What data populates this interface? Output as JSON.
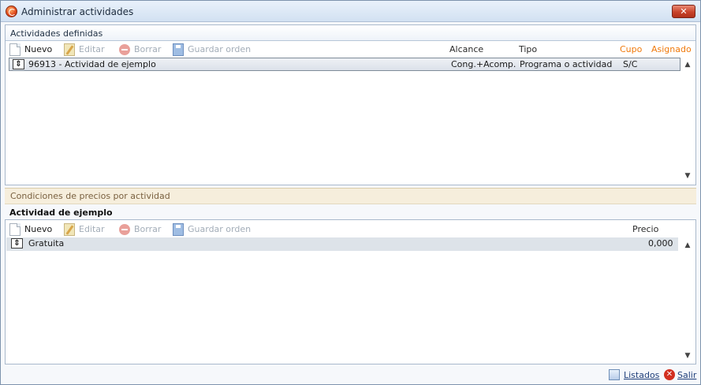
{
  "window": {
    "title": "Administrar actividades",
    "close_label": "✕"
  },
  "top_panel": {
    "header": "Actividades definidas",
    "toolbar": {
      "new": "Nuevo",
      "edit": "Editar",
      "delete": "Borrar",
      "save_order": "Guardar orden"
    },
    "columns": {
      "alcance": "Alcance",
      "tipo": "Tipo",
      "cupo": "Cupo",
      "asignado": "Asignado"
    },
    "rows": [
      {
        "name": "96913 - Actividad de ejemplo",
        "alcance": "Cong.+Acomp.",
        "tipo": "Programa o actividad",
        "cupo": "S/C",
        "asignado": ""
      }
    ]
  },
  "conditions": {
    "header": "Condiciones de precios por actividad",
    "activity_title": "Actividad de ejemplo",
    "toolbar": {
      "new": "Nuevo",
      "edit": "Editar",
      "delete": "Borrar",
      "save_order": "Guardar orden"
    },
    "columns": {
      "precio": "Precio"
    },
    "rows": [
      {
        "name": "Gratuita",
        "precio": "0,000"
      }
    ]
  },
  "footer": {
    "listados": "Listados",
    "salir": "Salir"
  },
  "colors": {
    "accent_orange": "#f07a0c",
    "title_bar": "#d2e1f2",
    "band": "#f6eedc"
  }
}
